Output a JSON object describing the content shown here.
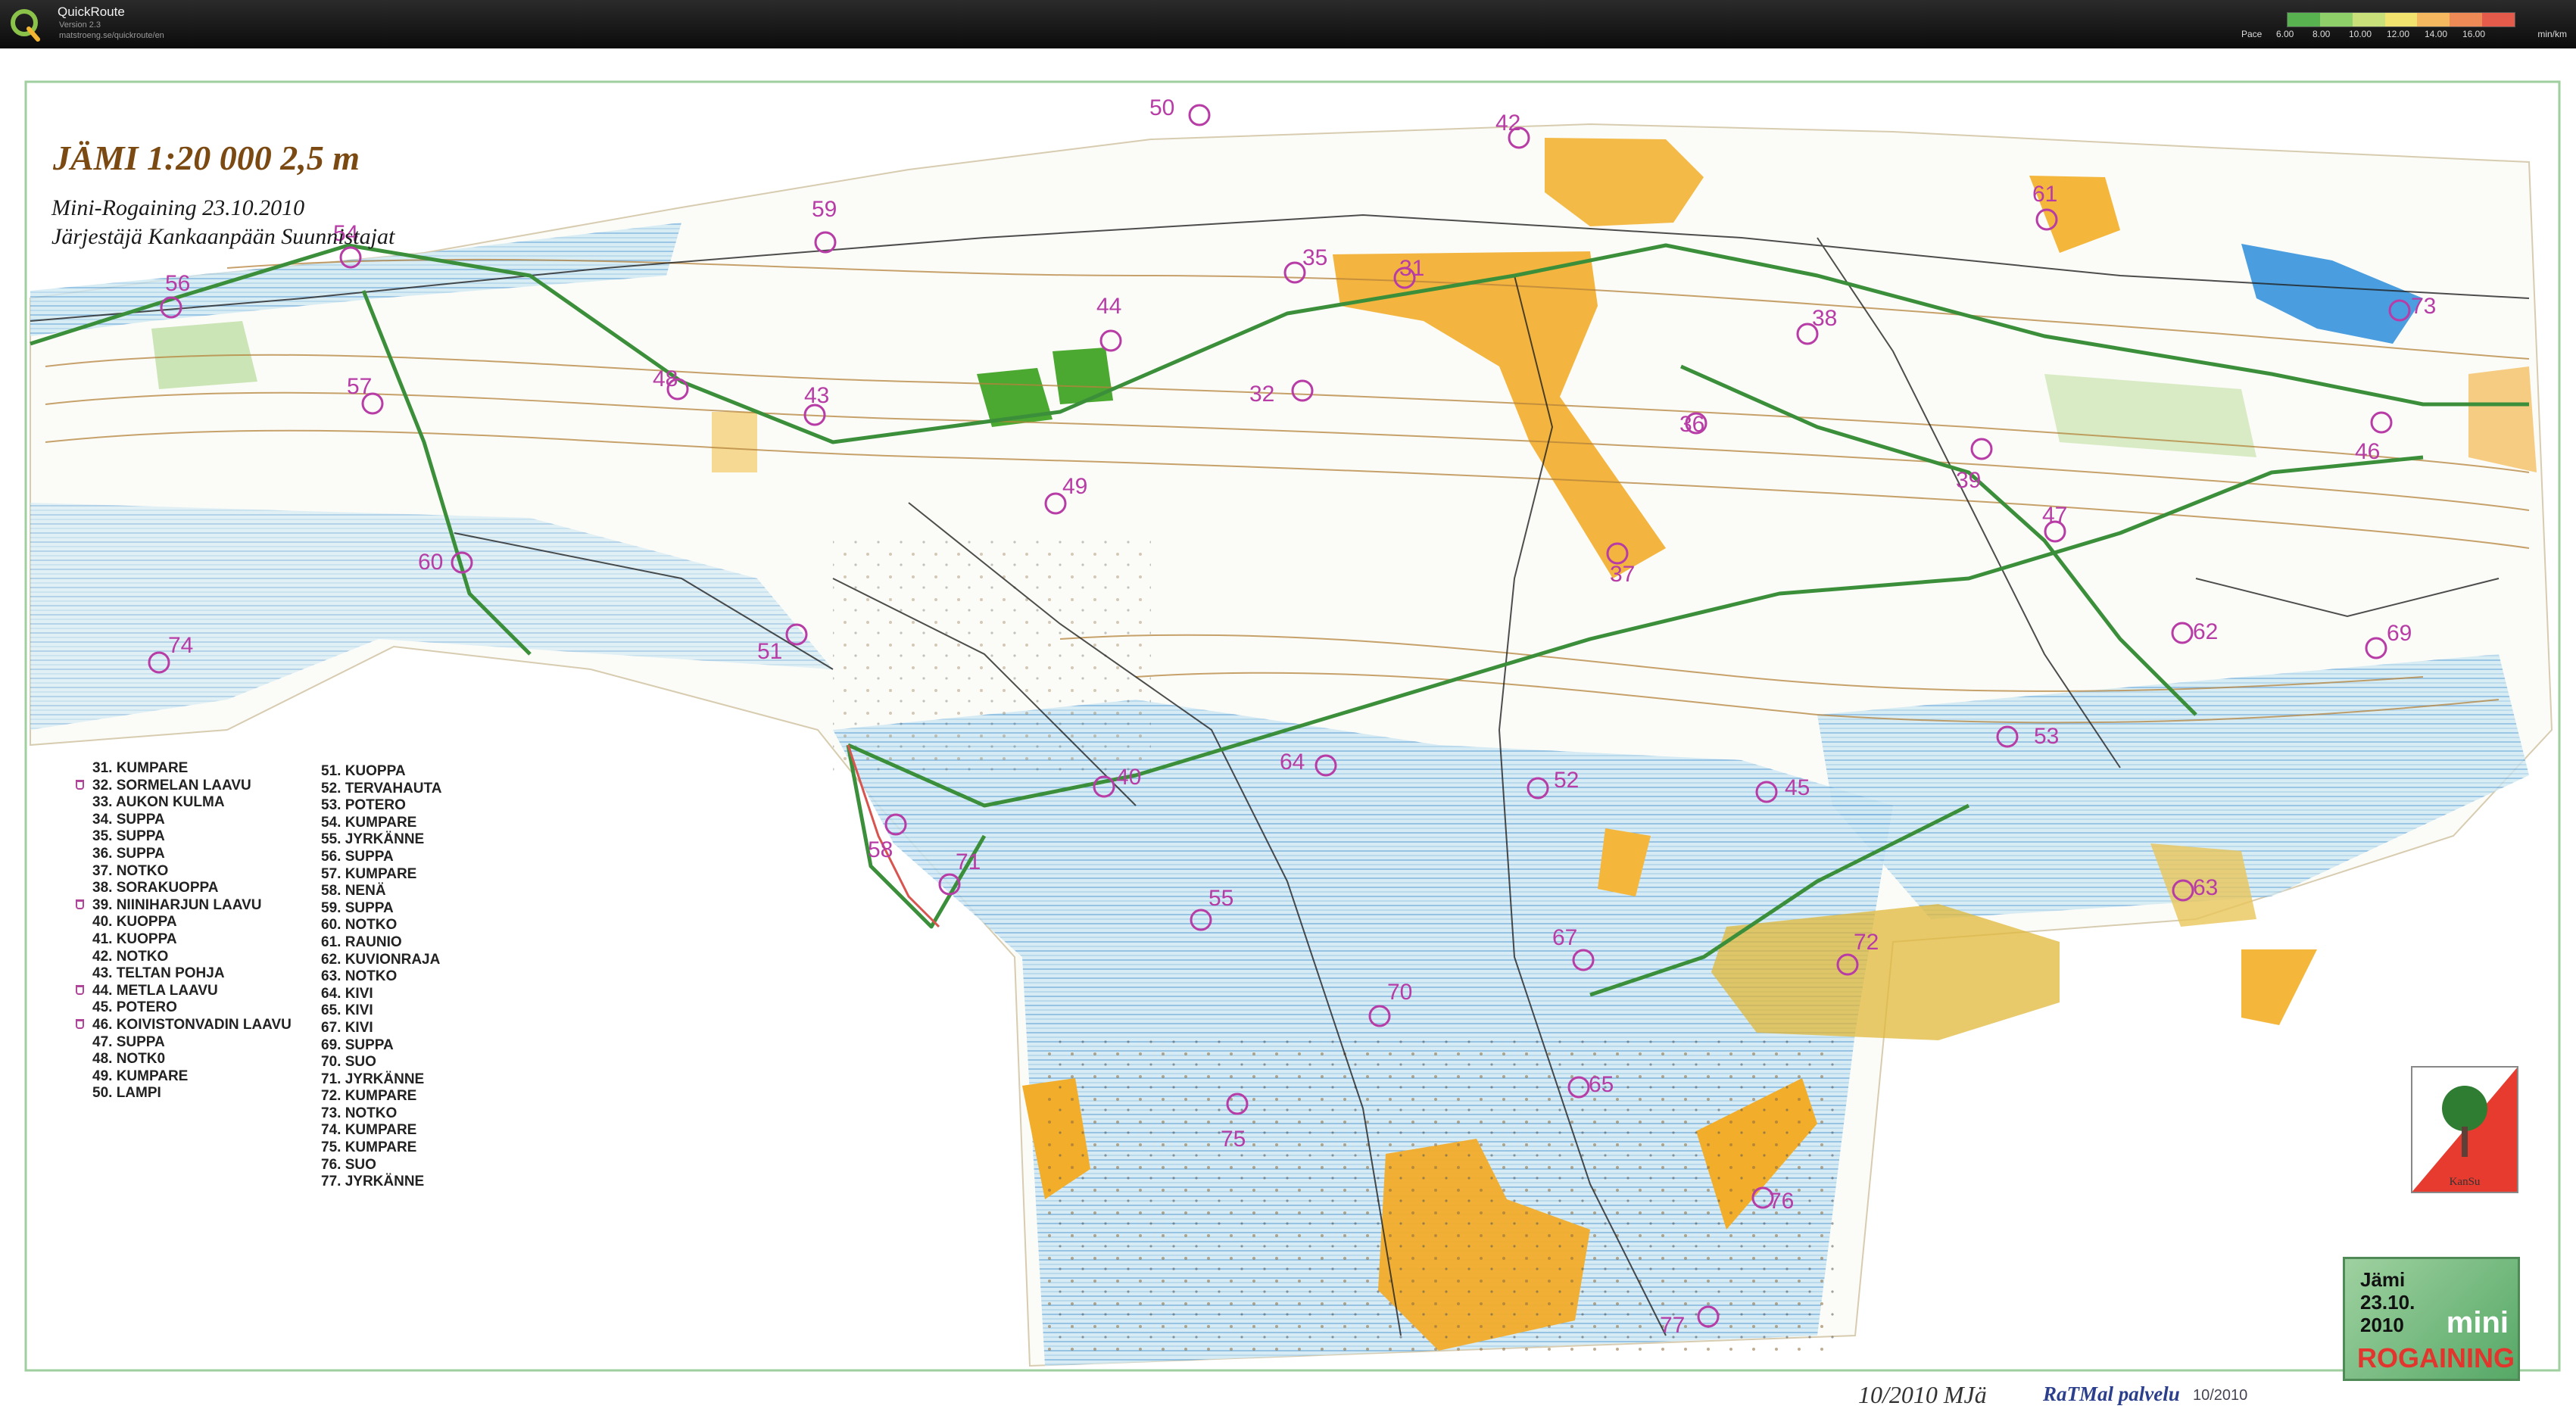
{
  "app": {
    "name": "QuickRoute",
    "version": "Version 2.3",
    "url": "matstroeng.se/quickroute/en"
  },
  "pace_legend": {
    "title": "Pace",
    "ticks": [
      "6.00",
      "8.00",
      "10.00",
      "12.00",
      "14.00",
      "16.00"
    ],
    "unit": "min/km",
    "colors": [
      "#57b24f",
      "#8fcf6a",
      "#c9e07a",
      "#f2e36e",
      "#f5b85f",
      "#ee8a55",
      "#e45a4b"
    ]
  },
  "map": {
    "title": "JÄMI   1:20 000   2,5 m",
    "event": "Mini-Rogaining  23.10.2010",
    "organizer": "Järjestäjä Kankaanpään Suunnistajat",
    "footer_mja": "10/2010 MJä",
    "footer_print": "RaTMal palvelu",
    "footer_date": "10/2010",
    "colors": {
      "open": "#f6c348",
      "water": "#5b9fd6",
      "marsh": "#b8dcec",
      "green": "#5fb848",
      "route": "#3c8f3a",
      "control": "#b73ca6",
      "contour": "#b5833c"
    },
    "controls": [
      {
        "num": "31"
      },
      {
        "num": "32"
      },
      {
        "num": "35"
      },
      {
        "num": "36"
      },
      {
        "num": "37"
      },
      {
        "num": "38"
      },
      {
        "num": "39"
      },
      {
        "num": "40"
      },
      {
        "num": "42"
      },
      {
        "num": "43"
      },
      {
        "num": "44"
      },
      {
        "num": "45"
      },
      {
        "num": "46"
      },
      {
        "num": "47"
      },
      {
        "num": "48"
      },
      {
        "num": "49"
      },
      {
        "num": "50"
      },
      {
        "num": "51"
      },
      {
        "num": "52"
      },
      {
        "num": "53"
      },
      {
        "num": "54"
      },
      {
        "num": "55"
      },
      {
        "num": "56"
      },
      {
        "num": "57"
      },
      {
        "num": "58"
      },
      {
        "num": "59"
      },
      {
        "num": "60"
      },
      {
        "num": "61"
      },
      {
        "num": "62"
      },
      {
        "num": "63"
      },
      {
        "num": "64"
      },
      {
        "num": "65"
      },
      {
        "num": "67"
      },
      {
        "num": "69"
      },
      {
        "num": "70"
      },
      {
        "num": "71"
      },
      {
        "num": "72"
      },
      {
        "num": "73"
      },
      {
        "num": "74"
      },
      {
        "num": "75"
      },
      {
        "num": "76"
      },
      {
        "num": "77"
      }
    ]
  },
  "legend_col1": [
    {
      "num": "31.",
      "name": "KUMPARE",
      "shelter": false
    },
    {
      "num": "32.",
      "name": "SORMELAN LAAVU",
      "shelter": true
    },
    {
      "num": "33.",
      "name": "AUKON KULMA",
      "shelter": false
    },
    {
      "num": "34.",
      "name": "SUPPA",
      "shelter": false
    },
    {
      "num": "35.",
      "name": "SUPPA",
      "shelter": false
    },
    {
      "num": "36.",
      "name": "SUPPA",
      "shelter": false
    },
    {
      "num": "37.",
      "name": "NOTKO",
      "shelter": false
    },
    {
      "num": "38.",
      "name": "SORAKUOPPA",
      "shelter": false
    },
    {
      "num": "39.",
      "name": "NIINIHARJUN LAAVU",
      "shelter": true
    },
    {
      "num": "40.",
      "name": "KUOPPA",
      "shelter": false
    },
    {
      "num": "41.",
      "name": "KUOPPA",
      "shelter": false
    },
    {
      "num": "42.",
      "name": "NOTKO",
      "shelter": false
    },
    {
      "num": "43.",
      "name": "TELTAN POHJA",
      "shelter": false
    },
    {
      "num": "44.",
      "name": "METLA LAAVU",
      "shelter": true
    },
    {
      "num": "45.",
      "name": "POTERO",
      "shelter": false
    },
    {
      "num": "46.",
      "name": "KOIVISTONVADIN LAAVU",
      "shelter": true
    },
    {
      "num": "47.",
      "name": "SUPPA",
      "shelter": false
    },
    {
      "num": "48.",
      "name": "NOTK0",
      "shelter": false
    },
    {
      "num": "49.",
      "name": "KUMPARE",
      "shelter": false
    },
    {
      "num": "50.",
      "name": "LAMPI",
      "shelter": false
    }
  ],
  "legend_col2": [
    {
      "num": "51.",
      "name": "KUOPPA"
    },
    {
      "num": "52.",
      "name": "TERVAHAUTA"
    },
    {
      "num": "53.",
      "name": "POTERO"
    },
    {
      "num": "54.",
      "name": "KUMPARE"
    },
    {
      "num": "55.",
      "name": "JYRKÄNNE"
    },
    {
      "num": "56.",
      "name": "SUPPA"
    },
    {
      "num": "57.",
      "name": "KUMPARE"
    },
    {
      "num": "58.",
      "name": "NENÄ"
    },
    {
      "num": "59.",
      "name": "SUPPA"
    },
    {
      "num": "60.",
      "name": "NOTKO"
    },
    {
      "num": "61.",
      "name": "RAUNIO"
    },
    {
      "num": "62.",
      "name": "KUVIONRAJA"
    },
    {
      "num": "63.",
      "name": "NOTKO"
    },
    {
      "num": "64.",
      "name": "KIVI"
    },
    {
      "num": "65.",
      "name": "KIVI"
    },
    {
      "num": "67.",
      "name": "KIVI"
    },
    {
      "num": "69.",
      "name": "SUPPA"
    },
    {
      "num": "70.",
      "name": "SUO"
    },
    {
      "num": "71.",
      "name": "JYRKÄNNE"
    },
    {
      "num": "72.",
      "name": "KUMPARE"
    },
    {
      "num": "73.",
      "name": "NOTKO"
    },
    {
      "num": "74.",
      "name": "KUMPARE"
    },
    {
      "num": "75.",
      "name": "KUMPARE"
    },
    {
      "num": "76.",
      "name": "SUO"
    },
    {
      "num": "77.",
      "name": "JYRKÄNNE"
    }
  ],
  "club_logo": {
    "name": "KanSu"
  },
  "event_logo": {
    "line1": "Jämi",
    "line2": "23.10.",
    "line3": "2010",
    "mini": "mini",
    "rogaining": "ROGAINING"
  }
}
